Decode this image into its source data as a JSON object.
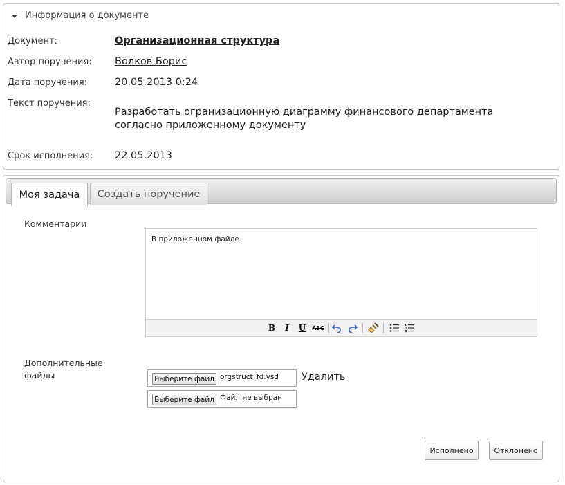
{
  "doc_info": {
    "header": "Информация о документе",
    "fields": {
      "document_label": "Документ:",
      "document_value": "Организационная структура",
      "author_label": "Автор поручения:",
      "author_value": "Волков Борис",
      "date_label": "Дата поручения:",
      "date_value": "20.05.2013 0:24",
      "text_label": "Текст поручения:",
      "text_value": "Разработать огранизационную диаграмму финансового департамента согласно приложенному документу",
      "deadline_label": "Срок исполнения:",
      "deadline_value": "22.05.2013"
    }
  },
  "tabs": [
    {
      "label": "Моя задача",
      "active": true
    },
    {
      "label": "Создать поручение",
      "active": false
    }
  ],
  "form": {
    "comments_label": "Комментарии",
    "editor_text": "В приложенном файле",
    "toolbar": {
      "bold": "B",
      "italic": "I",
      "underline": "U",
      "strike": "ABC",
      "icons": [
        "undo-icon",
        "redo-icon",
        "clear-format-icon",
        "bulleted-list-icon",
        "numbered-list-icon"
      ]
    },
    "files_label": "Дополнительные файлы",
    "files": [
      {
        "button": "Выберите файл",
        "filename": "orgstruct_fd.vsd"
      },
      {
        "button": "Выберите файл",
        "filename": "Файл не выбран"
      }
    ],
    "delete_label": "Удалить"
  },
  "actions": {
    "done": "Исполнено",
    "rejected": "Отклонено"
  }
}
